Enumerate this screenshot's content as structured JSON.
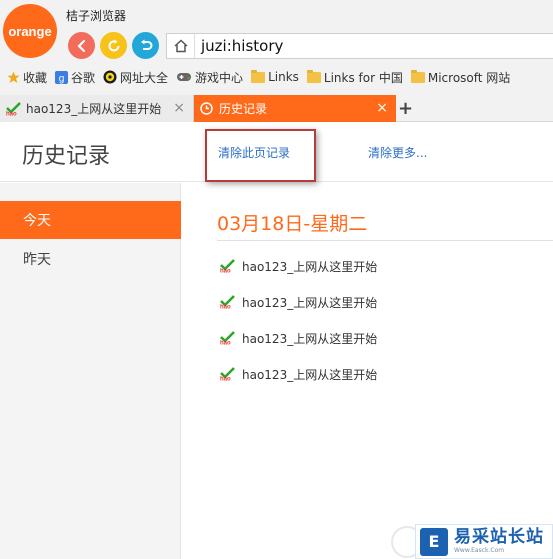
{
  "app": {
    "logo_text": "orange",
    "title": "桔子浏览器"
  },
  "address_bar": {
    "url": "juzi:history"
  },
  "bookmarks": [
    {
      "label": "收藏",
      "icon": "star-icon"
    },
    {
      "label": "谷歌",
      "icon": "google-icon"
    },
    {
      "label": "网址大全",
      "icon": "sitemap-icon"
    },
    {
      "label": "游戏中心",
      "icon": "gamepad-icon"
    },
    {
      "label": "Links",
      "icon": "folder-icon"
    },
    {
      "label": "Links for 中国",
      "icon": "folder-icon"
    },
    {
      "label": "Microsoft 网站",
      "icon": "folder-icon"
    }
  ],
  "tabs": [
    {
      "label": "hao123_上网从这里开始",
      "close": "×"
    },
    {
      "label": "历史记录",
      "close": "×"
    }
  ],
  "new_tab": "+",
  "page": {
    "title": "历史记录",
    "clear_page_label": "清除此页记录",
    "clear_more_label": "清除更多..."
  },
  "sidebar": {
    "items": [
      {
        "label": "今天"
      },
      {
        "label": "昨天"
      }
    ]
  },
  "history": {
    "date": "03月18日-星期二",
    "entries": [
      {
        "title": "hao123_上网从这里开始"
      },
      {
        "title": "hao123_上网从这里开始"
      },
      {
        "title": "hao123_上网从这里开始"
      },
      {
        "title": "hao123_上网从这里开始"
      }
    ]
  },
  "watermark": {
    "logo": "E",
    "text": "易采站长站",
    "sub": "Www.Easck.Com"
  },
  "colors": {
    "accent": "#ff6a1a",
    "link": "#2b6fc4",
    "back": "#f26b5b",
    "refresh": "#f7c21a",
    "home": "#22a7d8"
  }
}
